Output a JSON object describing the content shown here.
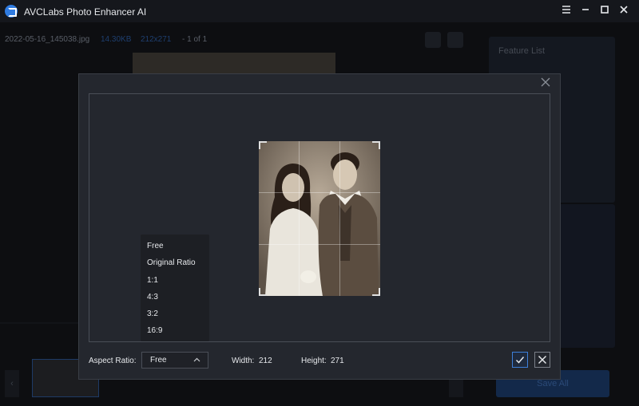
{
  "app": {
    "title": "AVCLabs Photo Enhancer AI"
  },
  "window": {
    "menu_icon": "hamburger-menu-icon",
    "minimize_icon": "minimize-icon",
    "maximize_icon": "maximize-icon",
    "close_icon": "close-icon"
  },
  "background": {
    "file_name": "2022-05-16_145038.jpg",
    "file_size": "14.30KB",
    "file_dims": "212x271",
    "page_count": "1 of 1",
    "feature_list_label": "Feature List",
    "save_all_label": "Save All"
  },
  "crop_dialog": {
    "aspect_label": "Aspect Ratio:",
    "aspect_selected": "Free",
    "aspect_options": [
      "Free",
      "Original Ratio",
      "1:1",
      "4:3",
      "3:2",
      "16:9"
    ],
    "width_label": "Width:",
    "width_value": "212",
    "height_label": "Height:",
    "height_value": "271"
  },
  "colors": {
    "accent": "#3d7fd9",
    "modal_bg": "#24272e",
    "app_bg": "#15171c"
  }
}
